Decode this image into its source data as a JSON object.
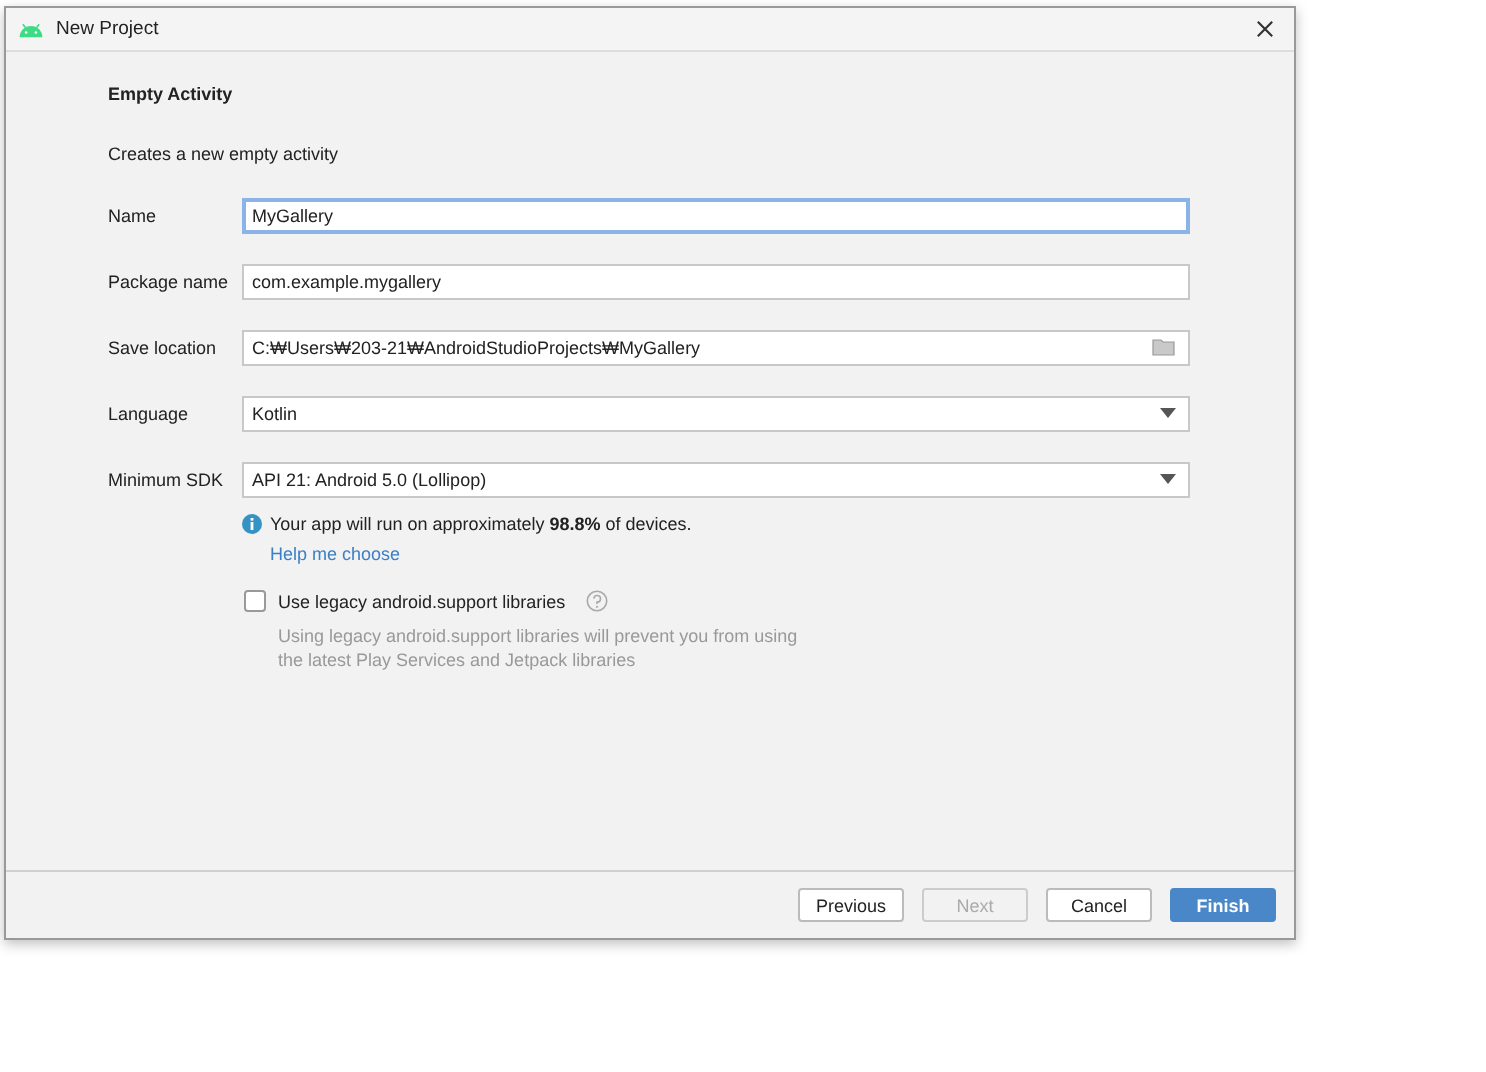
{
  "window": {
    "title": "New Project"
  },
  "heading": "Empty Activity",
  "description": "Creates a new empty activity",
  "fields": [
    {
      "label": "Name",
      "kind": "text",
      "value": "MyGallery",
      "focused": true
    },
    {
      "label": "Package name",
      "kind": "text",
      "value": "com.example.mygallery",
      "focused": false
    },
    {
      "label": "Save location",
      "kind": "folder",
      "value": "C:₩Users₩203-21₩AndroidStudioProjects₩MyGallery",
      "focused": false
    },
    {
      "label": "Language",
      "kind": "dropdown",
      "value": "Kotlin",
      "focused": false
    },
    {
      "label": "Minimum SDK",
      "kind": "dropdown",
      "value": "API 21: Android 5.0 (Lollipop)",
      "focused": false
    }
  ],
  "info": {
    "text": "Your app will run on approximately **98.8%** of devices.",
    "link": "Help me choose"
  },
  "legacy": {
    "label": "Use legacy android.support libraries",
    "checked": false,
    "note": "Using legacy android.support libraries will prevent you from using the latest Play Services and Jetpack libraries"
  },
  "buttons": [
    {
      "label": "Previous",
      "kind": "default"
    },
    {
      "label": "Next",
      "kind": "disabled"
    },
    {
      "label": "Cancel",
      "kind": "default"
    },
    {
      "label": "Finish",
      "kind": "primary"
    }
  ]
}
